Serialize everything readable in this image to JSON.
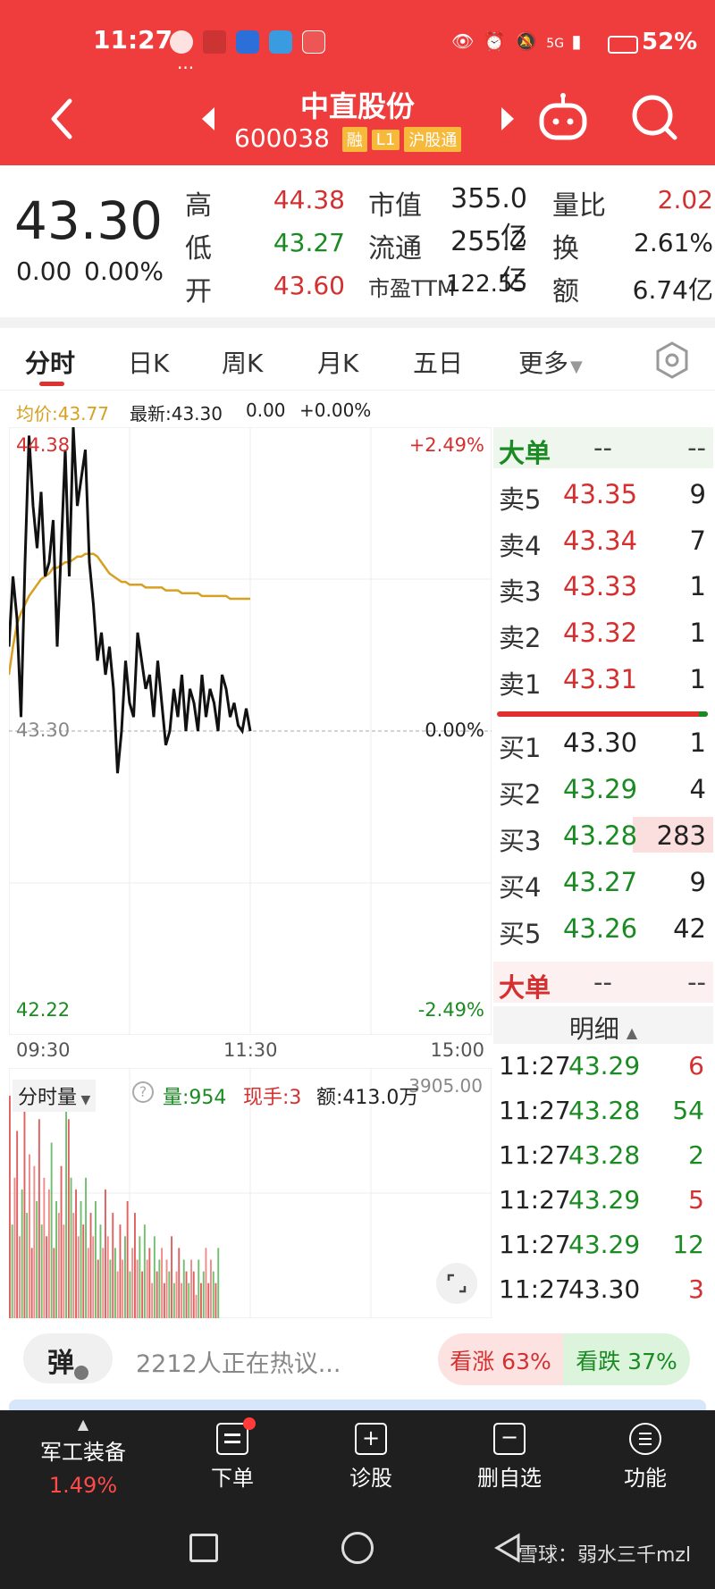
{
  "status_bar": {
    "time": "11:27",
    "battery": "52%",
    "network": "5G"
  },
  "header": {
    "stock_name": "中直股份",
    "stock_code": "600038",
    "tags": [
      "融",
      "L1",
      "沪股通"
    ]
  },
  "quote": {
    "price": "43.30",
    "change": "0.00",
    "change_pct": "0.00%",
    "rows": [
      {
        "l1": "高",
        "v1": "44.38",
        "l2": "市值",
        "v2": "355.0亿",
        "l3": "量比",
        "v3": "2.02"
      },
      {
        "l1": "低",
        "v1": "43.27",
        "l2": "流通",
        "v2": "255.2亿",
        "l3": "换",
        "v3": "2.61%"
      },
      {
        "l1": "开",
        "v1": "43.60",
        "l2": "市盈TTM",
        "v2": "122.55",
        "l3": "额",
        "v3": "6.74亿"
      }
    ]
  },
  "tabs": [
    "分时",
    "日K",
    "周K",
    "月K",
    "五日",
    "更多"
  ],
  "info_line": {
    "avg_label": "均价:43.77",
    "latest_label": "最新:43.30",
    "change": "0.00",
    "change_pct": "+0.00%"
  },
  "chart_data": {
    "type": "line",
    "x_ticks": [
      "09:30",
      "11:30",
      "15:00"
    ],
    "ylim": [
      42.22,
      44.38
    ],
    "y_labels": {
      "top": "44.38",
      "mid": "43.30",
      "bottom": "42.22",
      "top_pct": "+2.49%",
      "mid_pct": "0.00%",
      "bottom_pct": "-2.49%"
    },
    "series": [
      {
        "name": "price",
        "color": "#111111",
        "values": [
          43.6,
          43.85,
          43.7,
          43.35,
          43.9,
          44.35,
          44.1,
          43.95,
          44.15,
          43.85,
          43.9,
          44.05,
          43.6,
          43.95,
          44.3,
          43.85,
          44.38,
          44.1,
          44.2,
          44.3,
          43.9,
          43.75,
          43.55,
          43.65,
          43.5,
          43.6,
          43.45,
          43.15,
          43.3,
          43.55,
          43.4,
          43.35,
          43.65,
          43.55,
          43.45,
          43.5,
          43.35,
          43.55,
          43.4,
          43.25,
          43.3,
          43.45,
          43.35,
          43.5,
          43.3,
          43.45,
          43.4,
          43.3,
          43.5,
          43.35,
          43.45,
          43.4,
          43.3,
          43.5,
          43.45,
          43.35,
          43.4,
          43.32,
          43.3,
          43.38,
          43.3
        ]
      },
      {
        "name": "均价",
        "color": "#d8a020",
        "values": [
          43.5,
          43.6,
          43.68,
          43.72,
          43.75,
          43.78,
          43.8,
          43.82,
          43.84,
          43.85,
          43.86,
          43.88,
          43.88,
          43.89,
          43.9,
          43.9,
          43.91,
          43.92,
          43.92,
          43.93,
          43.93,
          43.93,
          43.92,
          43.9,
          43.88,
          43.86,
          43.85,
          43.84,
          43.83,
          43.83,
          43.82,
          43.82,
          43.82,
          43.82,
          43.81,
          43.81,
          43.81,
          43.81,
          43.81,
          43.8,
          43.8,
          43.8,
          43.8,
          43.79,
          43.79,
          43.79,
          43.79,
          43.79,
          43.78,
          43.78,
          43.78,
          43.78,
          43.78,
          43.78,
          43.78,
          43.77,
          43.77,
          43.77,
          43.77,
          43.77,
          43.77
        ]
      }
    ]
  },
  "volume": {
    "label": "分时量",
    "qty": "量:954",
    "now": "现手:3",
    "amount": "额:413.0万",
    "max_label": "3905.00",
    "bars": [
      95,
      40,
      60,
      80,
      35,
      55,
      90,
      45,
      70,
      30,
      65,
      50,
      85,
      40,
      60,
      35,
      55,
      75,
      30,
      50,
      45,
      65,
      40,
      95,
      85,
      60,
      45,
      55,
      35,
      50,
      40,
      60,
      30,
      45,
      35,
      50,
      25,
      40,
      30,
      55,
      35,
      25,
      45,
      30,
      20,
      40,
      25,
      35,
      50,
      20,
      30,
      45,
      25,
      35,
      20,
      40,
      25,
      30,
      15,
      35,
      20,
      25,
      30,
      15,
      25,
      20,
      35,
      15,
      20,
      30,
      15,
      25,
      20,
      15,
      25,
      20,
      10,
      25,
      15,
      20,
      30,
      15,
      25,
      20,
      15,
      30
    ]
  },
  "order_book": {
    "big_order_label": "大单",
    "big_order_vals": [
      "--",
      "--"
    ],
    "sells": [
      {
        "label": "卖5",
        "price": "43.35",
        "vol": "9"
      },
      {
        "label": "卖4",
        "price": "43.34",
        "vol": "7"
      },
      {
        "label": "卖3",
        "price": "43.33",
        "vol": "1"
      },
      {
        "label": "卖2",
        "price": "43.32",
        "vol": "1"
      },
      {
        "label": "卖1",
        "price": "43.31",
        "vol": "1"
      }
    ],
    "buys": [
      {
        "label": "买1",
        "price": "43.30",
        "vol": "1"
      },
      {
        "label": "买2",
        "price": "43.29",
        "vol": "4"
      },
      {
        "label": "买3",
        "price": "43.28",
        "vol": "283"
      },
      {
        "label": "买4",
        "price": "43.27",
        "vol": "9"
      },
      {
        "label": "买5",
        "price": "43.26",
        "vol": "42"
      }
    ],
    "big_order2_label": "大单",
    "detail_label": "明细"
  },
  "ticks": [
    {
      "time": "11:27",
      "price": "43.29",
      "vol": "6"
    },
    {
      "time": "11:27",
      "price": "43.28",
      "vol": "54"
    },
    {
      "time": "11:27",
      "price": "43.28",
      "vol": "2"
    },
    {
      "time": "11:27",
      "price": "43.29",
      "vol": "5"
    },
    {
      "time": "11:27",
      "price": "43.29",
      "vol": "12"
    },
    {
      "time": "11:27",
      "price": "43.30",
      "vol": "3"
    }
  ],
  "discussion": {
    "danmu": "弹",
    "text": "2212人正在热议...",
    "up": "看涨 63%",
    "down": "看跌 37%"
  },
  "bottom_nav": {
    "sector_name": "军工装备",
    "sector_change": "1.49%",
    "items": [
      "下单",
      "诊股",
      "删自选",
      "功能"
    ]
  },
  "watermark": "雪球：弱水三千mzl"
}
